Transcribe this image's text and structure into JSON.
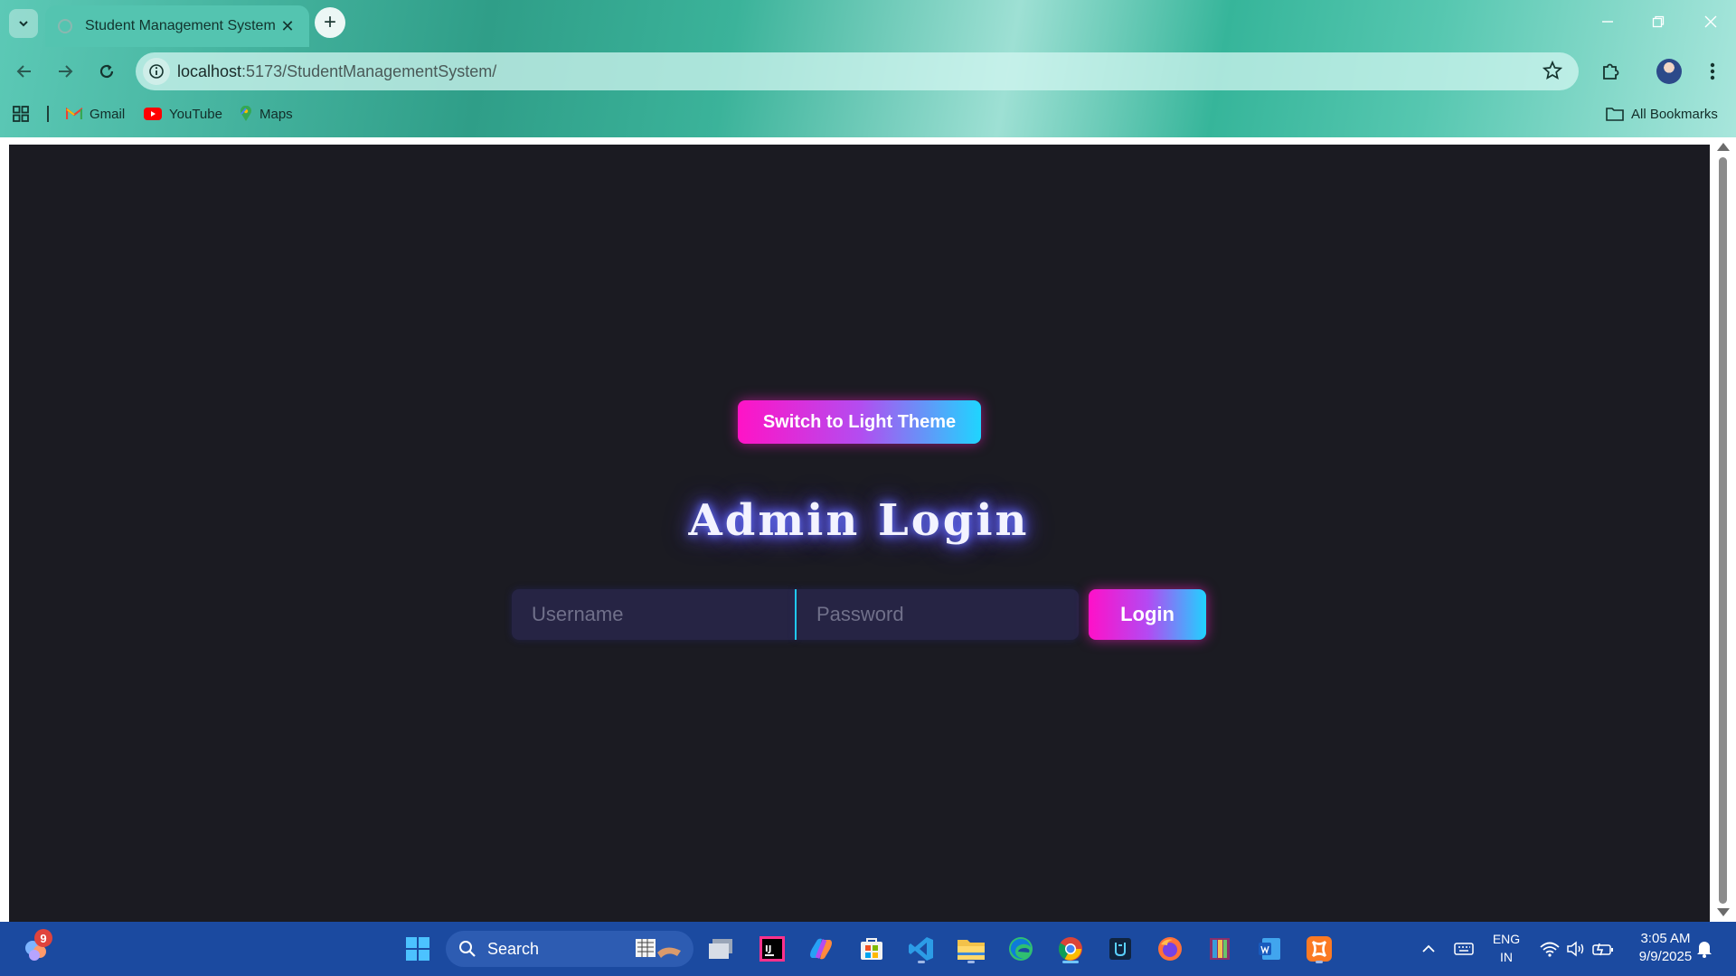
{
  "browser": {
    "tab_title": "Student Management System",
    "url_host": "localhost",
    "url_rest": ":5173/StudentManagementSystem/",
    "bookmarks": [
      {
        "label": "Gmail",
        "icon": "gmail-icon"
      },
      {
        "label": "YouTube",
        "icon": "youtube-icon"
      },
      {
        "label": "Maps",
        "icon": "maps-icon"
      }
    ],
    "all_bookmarks_label": "All Bookmarks"
  },
  "page": {
    "theme_toggle_label": "Switch to Light Theme",
    "title": "Admin Login",
    "username_placeholder": "Username",
    "password_placeholder": "Password",
    "login_label": "Login",
    "colors": {
      "background": "#1b1b22",
      "gradient_start": "#ff13c6",
      "gradient_end": "#1fd5ff",
      "input_bg": "#262444"
    }
  },
  "taskbar": {
    "search_label": "Search",
    "notification_count": "9",
    "language_line1": "ENG",
    "language_line2": "IN",
    "time": "3:05 AM",
    "date": "9/9/2025",
    "accent": "#1b4aa0"
  }
}
